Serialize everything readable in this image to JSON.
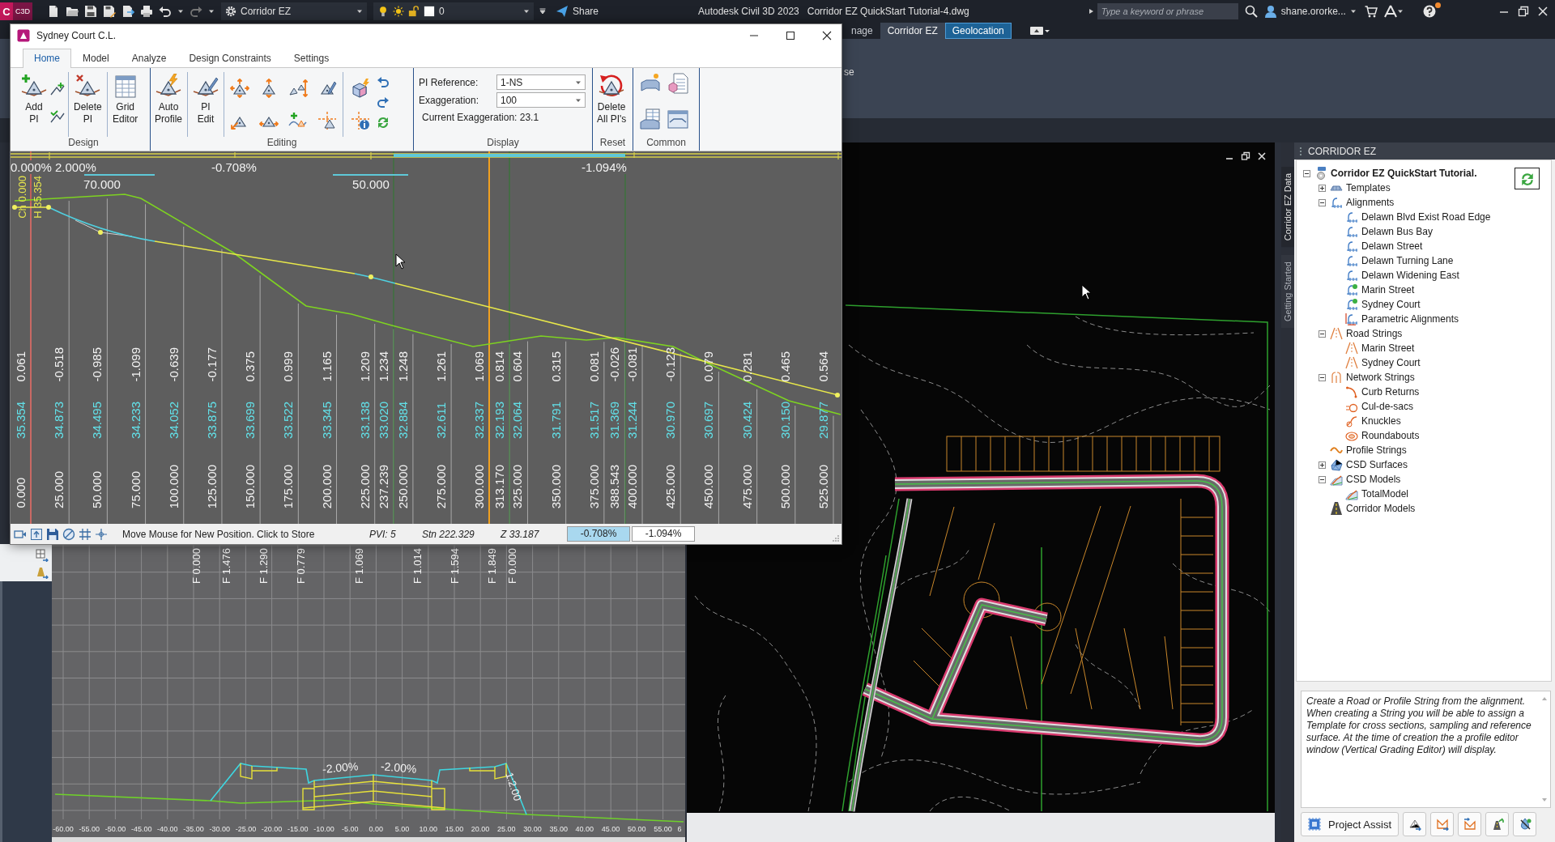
{
  "app_bar": {
    "logo": {
      "letter": "C",
      "badge": "C3D"
    },
    "workspace": "Corridor EZ",
    "layer": "0",
    "share": "Share",
    "product": "Autodesk Civil 3D 2023",
    "document": "Corridor EZ QuickStart Tutorial-4.dwg",
    "search": {
      "placeholder": "Type a keyword or phrase"
    },
    "user": "shane.ororke...",
    "help_notification": true
  },
  "ribbon": {
    "tabs": [
      {
        "label": "nage",
        "selected": false,
        "contextual": false
      },
      {
        "label": "Corridor EZ",
        "selected": true,
        "contextual": false
      },
      {
        "label": "Geolocation",
        "selected": false,
        "contextual": true
      }
    ],
    "panel_text": "se"
  },
  "profile_editor": {
    "title": "Sydney Court C.L.",
    "tabs": [
      {
        "label": "Home",
        "selected": true
      },
      {
        "label": "Model",
        "selected": false
      },
      {
        "label": "Analyze",
        "selected": false
      },
      {
        "label": "Design Constraints",
        "selected": false
      },
      {
        "label": "Settings",
        "selected": false
      }
    ],
    "design": {
      "label": "Design",
      "add_pi": "Add\nPI",
      "delete_pi": "Delete\nPI",
      "grid_editor": "Grid\nEditor"
    },
    "editing": {
      "label": "Editing",
      "auto_profile": "Auto\nProfile",
      "pi_edit": "PI\nEdit"
    },
    "display": {
      "label": "Display",
      "pi_reference": {
        "label": "PI Reference:",
        "value": "1-NS"
      },
      "exaggeration": {
        "label": "Exaggeration:",
        "value": "100"
      },
      "current_exaggeration": "Current Exaggeration: 23.1"
    },
    "reset": {
      "label": "Reset",
      "delete_all": "Delete\nAll PI's"
    },
    "common": {
      "label": "Common"
    },
    "profile": {
      "grades": [
        "0.000%",
        "2.000%",
        "-0.708%",
        "-1.094%"
      ],
      "curve_lengths": [
        "70.000",
        "50.000"
      ],
      "chainage": "Ch 0.000",
      "height": "H 35.354",
      "columns": [
        {
          "difference": "0.061",
          "elevation": "35.354",
          "station": "0.000"
        },
        {
          "difference": "-0.518",
          "elevation": "34.873",
          "station": "25.000"
        },
        {
          "difference": "-0.985",
          "elevation": "34.495",
          "station": "50.000"
        },
        {
          "difference": "-1.099",
          "elevation": "34.233",
          "station": "75.000"
        },
        {
          "difference": "-0.639",
          "elevation": "34.052",
          "station": "100.000"
        },
        {
          "difference": "-0.177",
          "elevation": "33.875",
          "station": "125.000"
        },
        {
          "difference": "0.375",
          "elevation": "33.699",
          "station": "150.000"
        },
        {
          "difference": "0.999",
          "elevation": "33.522",
          "station": "175.000"
        },
        {
          "difference": "1.165",
          "elevation": "33.345",
          "station": "200.000"
        },
        {
          "difference": "1.209",
          "elevation": "33.138",
          "station": "225.000"
        },
        {
          "difference": "1.234",
          "elevation": "33.020",
          "station": "237.239"
        },
        {
          "difference": "1.248",
          "elevation": "32.884",
          "station": "250.000"
        },
        {
          "difference": "1.261",
          "elevation": "32.611",
          "station": "275.000"
        },
        {
          "difference": "1.069",
          "elevation": "32.337",
          "station": "300.000"
        },
        {
          "difference": "0.814",
          "elevation": "32.193",
          "station": "313.170"
        },
        {
          "difference": "0.604",
          "elevation": "32.064",
          "station": "325.000"
        },
        {
          "difference": "0.315",
          "elevation": "31.791",
          "station": "350.000"
        },
        {
          "difference": "0.081",
          "elevation": "31.517",
          "station": "375.000"
        },
        {
          "difference": "-0.026",
          "elevation": "31.369",
          "station": "388.543"
        },
        {
          "difference": "-0.081",
          "elevation": "31.244",
          "station": "400.000"
        },
        {
          "difference": "-0.123",
          "elevation": "30.970",
          "station": "425.000"
        },
        {
          "difference": "0.079",
          "elevation": "30.697",
          "station": "450.000"
        },
        {
          "difference": "0.281",
          "elevation": "30.424",
          "station": "475.000"
        },
        {
          "difference": "0.465",
          "elevation": "30.150",
          "station": "500.000"
        },
        {
          "difference": "0.564",
          "elevation": "29.877",
          "station": "525.000"
        }
      ]
    },
    "status_bar": {
      "message": "Move Mouse for New Position. Click to Store",
      "pvi": "PVI: 5",
      "station": "Stn 222.329",
      "elevation": "Z 33.187",
      "grades": [
        {
          "label": "-0.708%",
          "selected": true
        },
        {
          "label": "-1.094%",
          "selected": false
        }
      ]
    }
  },
  "cross_section": {
    "fill_labels": [
      "F 0.000",
      "F 1.476",
      "F 1.290",
      "F 0.779",
      "F 1.069",
      "F 1.014",
      "F 1.594",
      "F 1.849",
      "F 0.000"
    ],
    "grade_labels": [
      "-2.00%",
      "-2.00%"
    ],
    "slope_label": "1:2.00",
    "offsets": [
      "-60.00",
      "-55.00",
      "-50.00",
      "-45.00",
      "-40.00",
      "-35.00",
      "-30.00",
      "-25.00",
      "-20.00",
      "-15.00",
      "-10.00",
      "-5.00",
      "0.00",
      "5.00",
      "10.00",
      "15.00",
      "20.00",
      "25.00",
      "30.00",
      "35.00",
      "40.00",
      "45.00",
      "50.00",
      "55.00",
      "6"
    ]
  },
  "corridor_panel": {
    "title": "CORRIDOR EZ",
    "side_tabs": [
      {
        "label": "Corridor EZ Data",
        "selected": true
      },
      {
        "label": "Getting Started",
        "selected": false
      }
    ],
    "tree": [
      {
        "label": "Corridor EZ QuickStart Tutorial.",
        "kind": "drawing",
        "expanded": true,
        "children": [
          {
            "label": "Templates",
            "kind": "templates",
            "expanded": false
          },
          {
            "label": "Alignments",
            "kind": "alignment",
            "expanded": true,
            "children": [
              {
                "label": "Delawn Blvd Exist Road Edge",
                "kind": "alignment"
              },
              {
                "label": "Delawn Bus Bay",
                "kind": "alignment"
              },
              {
                "label": "Delawn Street",
                "kind": "alignment"
              },
              {
                "label": "Delawn Turning Lane",
                "kind": "alignment"
              },
              {
                "label": "Delawn Widening East",
                "kind": "alignment"
              },
              {
                "label": "Marin Street",
                "kind": "alignment-linked"
              },
              {
                "label": "Sydney Court",
                "kind": "alignment-linked"
              },
              {
                "label": "Parametric Alignments",
                "kind": "parametric"
              }
            ]
          },
          {
            "label": "Road Strings",
            "kind": "road",
            "expanded": true,
            "children": [
              {
                "label": "Marin Street",
                "kind": "road"
              },
              {
                "label": "Sydney Court",
                "kind": "road"
              }
            ]
          },
          {
            "label": "Network Strings",
            "kind": "network",
            "expanded": true,
            "children": [
              {
                "label": "Curb Returns",
                "kind": "curb"
              },
              {
                "label": "Cul-de-sacs",
                "kind": "culdesac"
              },
              {
                "label": "Knuckles",
                "kind": "knuckle"
              },
              {
                "label": "Roundabouts",
                "kind": "roundabout"
              }
            ]
          },
          {
            "label": "Profile Strings",
            "kind": "profile"
          },
          {
            "label": "CSD Surfaces",
            "kind": "surface",
            "expanded": false
          },
          {
            "label": "CSD Models",
            "kind": "model",
            "expanded": true,
            "children": [
              {
                "label": "TotalModel",
                "kind": "model"
              }
            ]
          },
          {
            "label": "Corridor Models",
            "kind": "corridor"
          }
        ]
      }
    ],
    "help_text": "Create a Road or Profile String from the alignment. When creating a String you will be able to assign a Template for cross sections, sampling and reference surface. At the time of creation the a profile editor window (Vertical Grading Editor) will display.",
    "project_assist": "Project Assist"
  }
}
